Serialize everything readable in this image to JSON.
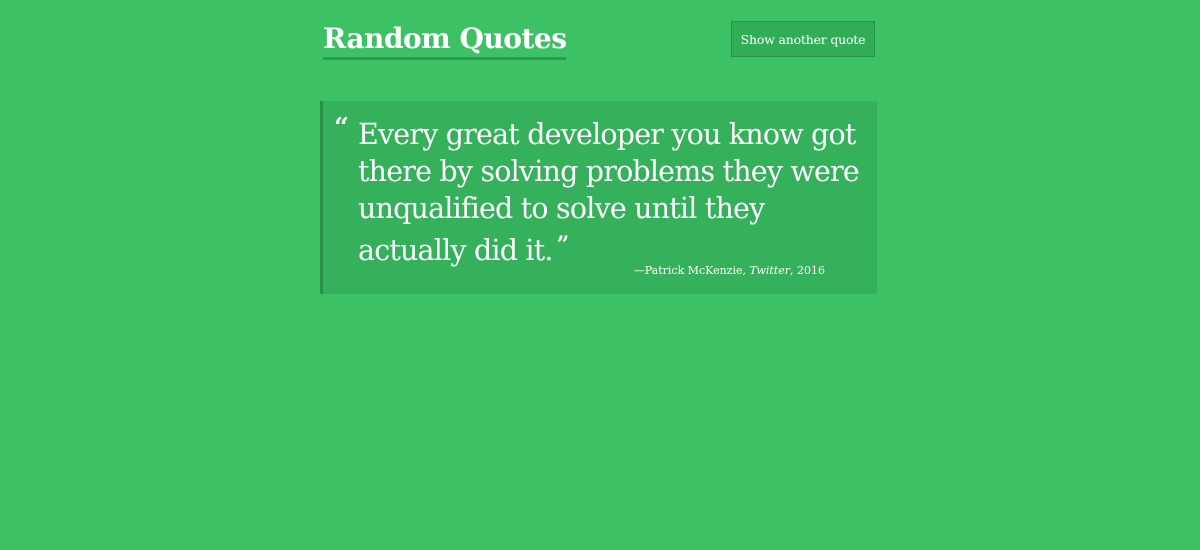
{
  "header": {
    "title": "Random Quotes",
    "button_label": "Show another quote"
  },
  "quote": {
    "open_mark": "“",
    "text": "Every great developer you know got there by solving problems they were unqualified to solve until they actually did it.",
    "close_mark": "”",
    "dash": "—",
    "author": "Patrick McKenzie",
    "separator": ", ",
    "source": "Twitter",
    "year_separator": ", ",
    "year": "2016"
  },
  "colors": {
    "background": "#3cc264",
    "quote_box": "#35b05b",
    "accent": "#2a8f48",
    "text": "#ffffff"
  }
}
